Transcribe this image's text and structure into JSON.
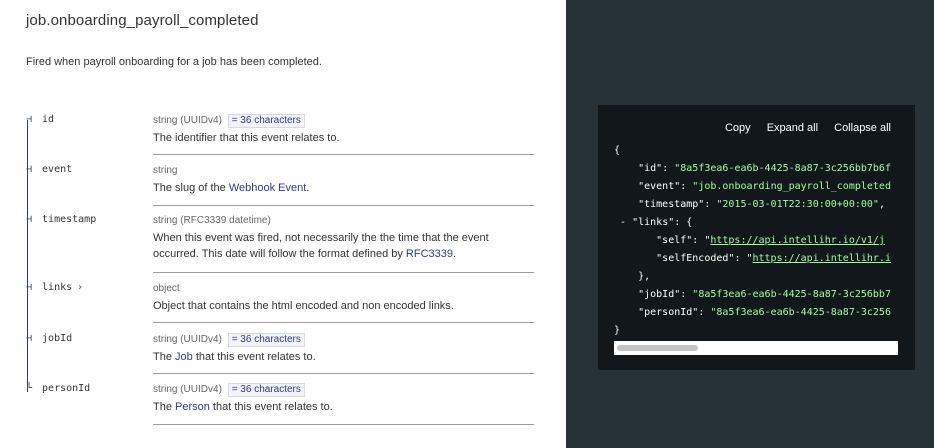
{
  "event": {
    "title": "job.onboarding_payroll_completed",
    "description": "Fired when payroll onboarding for a job has been completed."
  },
  "properties": [
    {
      "name": "id",
      "type": "string (UUIDv4)",
      "badge": "= 36 characters",
      "desc": "The identifier that this event relates to."
    },
    {
      "name": "event",
      "type": "string",
      "desc_pre": "The slug of the ",
      "desc_link": "Webhook Event",
      "desc_post": "."
    },
    {
      "name": "timestamp",
      "type": "string (RFC3339 datetime)",
      "desc_line1": "When this event was fired, not necessarily the the time that the event",
      "desc_pre": "occurred. This date will follow the format defined by ",
      "desc_link": "RFC3339",
      "desc_post": "."
    },
    {
      "name": "links",
      "chevron": "›",
      "type": "object",
      "desc": "Object that contains the html encoded and non encoded links."
    },
    {
      "name": "jobId",
      "type": "string (UUIDv4)",
      "badge": "= 36 characters",
      "desc_pre": "The ",
      "desc_link": "Job",
      "desc_post": " that this event relates to."
    },
    {
      "name": "personId",
      "type": "string (UUIDv4)",
      "badge": "= 36 characters",
      "desc_pre": "The ",
      "desc_link": "Person",
      "desc_post": " that this event relates to."
    }
  ],
  "code": {
    "actions": {
      "copy": "Copy",
      "expand": "Expand all",
      "collapse": "Collapse all"
    },
    "open_brace": "{",
    "close_brace": "}",
    "toggle": "-",
    "lines": {
      "id_key": "\"id\"",
      "id_val": "\"8a5f3ea6-ea6b-4425-8a87-3c256bb7b6f",
      "event_key": "\"event\"",
      "event_val": "\"job.onboarding_payroll_completed",
      "ts_key": "\"timestamp\"",
      "ts_val": "\"2015-03-01T22:30:00+00:00\"",
      "links_key": "\"links\"",
      "links_open": "{",
      "self_key": "\"self\"",
      "self_url": "https://api.intellihr.io/v1/j",
      "selfenc_key": "\"selfEncoded\"",
      "selfenc_url": "https://api.intellihr.i",
      "links_close": "},",
      "jobid_key": "\"jobId\"",
      "jobid_val": "\"8a5f3ea6-ea6b-4425-8a87-3c256bb7",
      "personid_key": "\"personId\"",
      "personid_val": "\"8a5f3ea6-ea6b-4425-8a87-3c256"
    }
  },
  "colors": {
    "accent": "#2d3a8c",
    "code_bg": "#11171a",
    "panel_bg": "#263238",
    "code_string": "#a2fca2"
  },
  "icons": {
    "tree_branch": "tree-branch-icon",
    "chevron": "chevron-right-icon"
  }
}
